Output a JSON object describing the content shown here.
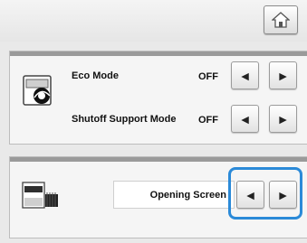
{
  "eco_mode": {
    "label": "Eco Mode",
    "value": "OFF"
  },
  "shutoff_support_mode": {
    "label": "Shutoff Support Mode",
    "value": "OFF"
  },
  "opening_screen": {
    "label": "Opening Screen"
  },
  "controls": {
    "left_arrow": "◄",
    "right_arrow": "►"
  },
  "icons": {
    "home": "home-icon",
    "eco": "eco-mode-icon",
    "screen": "opening-screen-icon"
  },
  "colors": {
    "highlight": "#2b8ad8"
  }
}
